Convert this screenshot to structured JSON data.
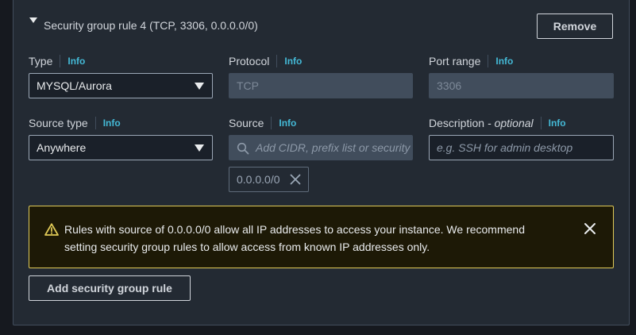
{
  "rule": {
    "title": "Security group rule 4 (TCP, 3306, 0.0.0.0/0)",
    "remove_label": "Remove"
  },
  "type": {
    "label": "Type",
    "info": "Info",
    "value": "MYSQL/Aurora"
  },
  "protocol": {
    "label": "Protocol",
    "info": "Info",
    "value": "TCP"
  },
  "port_range": {
    "label": "Port range",
    "info": "Info",
    "value": "3306"
  },
  "source_type": {
    "label": "Source type",
    "info": "Info",
    "value": "Anywhere"
  },
  "source": {
    "label": "Source",
    "info": "Info",
    "placeholder": "Add CIDR, prefix list or security",
    "token": "0.0.0.0/0"
  },
  "description": {
    "label": "Description",
    "label_suffix": "- optional",
    "info": "Info",
    "placeholder": "e.g. SSH for admin desktop"
  },
  "alert": {
    "text": "Rules with source of 0.0.0.0/0 allow all IP addresses to access your instance. We recommend setting security group rules to allow access from known IP addresses only."
  },
  "add_rule_label": "Add security group rule",
  "colors": {
    "info_link": "#44b9d6",
    "warning_border": "#e0ca57",
    "background": "#16191f",
    "panel": "#232a33"
  }
}
